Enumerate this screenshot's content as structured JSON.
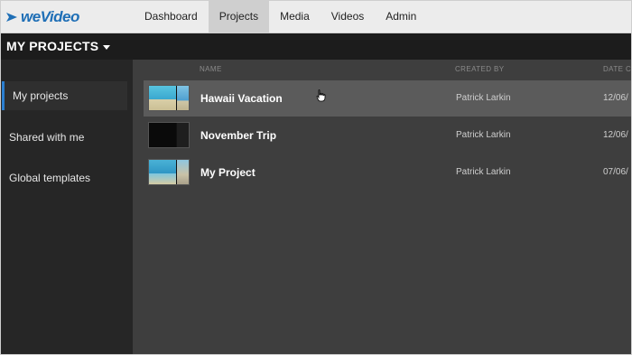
{
  "brand": {
    "logo_text": "weVideo",
    "accent": "#1f6fb6"
  },
  "nav": {
    "items": [
      {
        "label": "Dashboard",
        "active": false
      },
      {
        "label": "Projects",
        "active": true
      },
      {
        "label": "Media",
        "active": false
      },
      {
        "label": "Videos",
        "active": false
      },
      {
        "label": "Admin",
        "active": false
      }
    ]
  },
  "subheader": {
    "title": "MY PROJECTS"
  },
  "sidebar": {
    "items": [
      {
        "label": "My projects",
        "active": true
      },
      {
        "label": "Shared with me",
        "active": false
      },
      {
        "label": "Global templates",
        "active": false
      }
    ]
  },
  "table": {
    "columns": {
      "name": "NAME",
      "created_by": "CREATED BY",
      "date": "DATE C"
    },
    "rows": [
      {
        "name": "Hawaii Vacation",
        "created_by": "Patrick Larkin",
        "date": "12/06/",
        "thumb": "beach",
        "hover": true
      },
      {
        "name": "November Trip",
        "created_by": "Patrick Larkin",
        "date": "12/06/",
        "thumb": "dark",
        "hover": false
      },
      {
        "name": "My Project",
        "created_by": "Patrick Larkin",
        "date": "07/06/",
        "thumb": "beach2",
        "hover": false
      }
    ]
  }
}
